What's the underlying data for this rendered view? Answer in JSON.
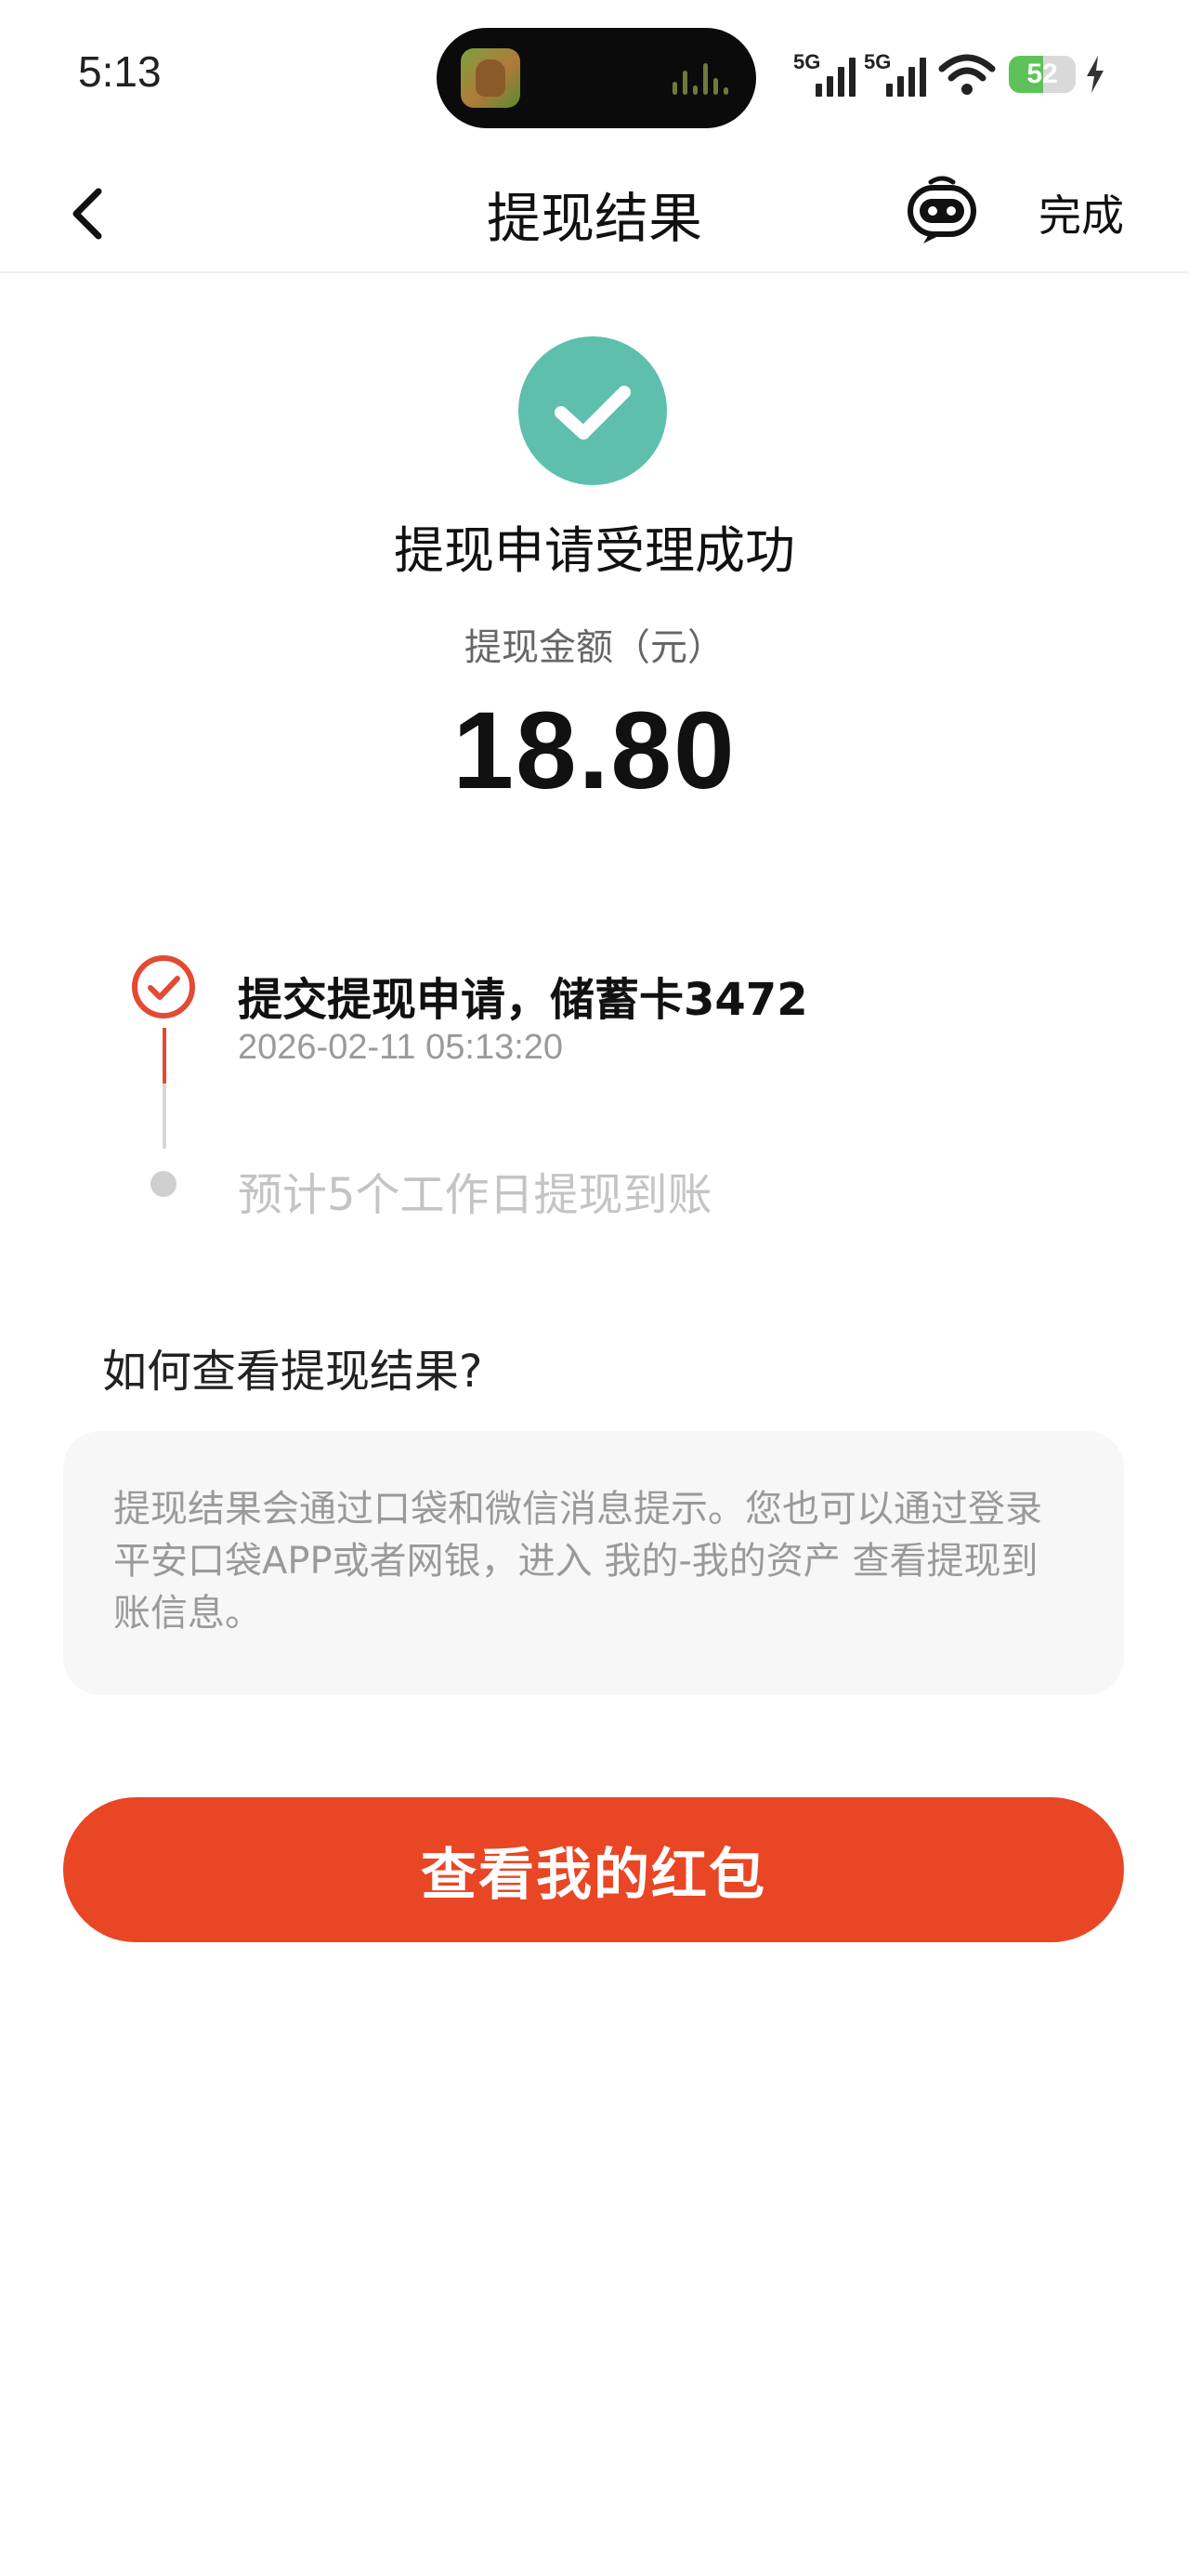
{
  "status_bar": {
    "time": "5:13",
    "signal_1_label": "5G",
    "signal_2_label": "5G",
    "battery_level": "52",
    "battery_fraction": 0.52,
    "battery_color": "#5ec25b"
  },
  "nav": {
    "back_icon": "chevron-left-icon",
    "title": "提现结果",
    "assistant_icon": "robot-face-icon",
    "done_label": "完成"
  },
  "result": {
    "icon": "check-circle-icon",
    "icon_color": "#5dbfac",
    "title": "提现申请受理成功",
    "amount_label": "提现金额（元）",
    "amount": "18.80"
  },
  "timeline": {
    "steps": [
      {
        "title": "提交提现申请，储蓄卡3472",
        "time": "2026-02-11 05:13:20",
        "status": "done",
        "icon": "check-circle-outline-icon",
        "color": "#e24a33"
      },
      {
        "title": "预计5个工作日提现到账",
        "status": "pending",
        "color": "#c4c4c4"
      }
    ]
  },
  "help": {
    "title": "如何查看提现结果?",
    "text": "提现结果会通过口袋和微信消息提示。您也可以通过登录平安口袋APP或者网银，进入 我的-我的资产 查看提现到账信息。"
  },
  "primary_button": {
    "label": "查看我的红包",
    "color": "#e94625"
  }
}
